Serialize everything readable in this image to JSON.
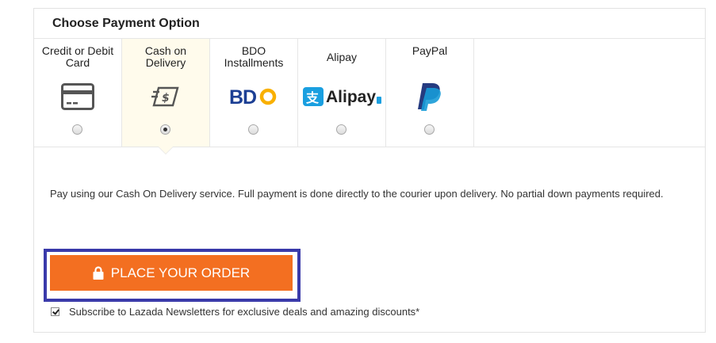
{
  "panel": {
    "title": "Choose Payment Option"
  },
  "payment_options": [
    {
      "label": "Credit or Debit Card",
      "icon": "credit-card-icon",
      "selected": false
    },
    {
      "label": "Cash on Delivery",
      "icon": "cash-on-delivery-icon",
      "selected": true
    },
    {
      "label": "BDO Installments",
      "icon": "bdo-logo",
      "logo_text": "BDO",
      "selected": false
    },
    {
      "label": "Alipay",
      "icon": "alipay-logo",
      "logo_text": "Alipay",
      "selected": false
    },
    {
      "label": "PayPal",
      "icon": "paypal-logo",
      "selected": false
    }
  ],
  "description": "Pay using our Cash On Delivery service. Full payment is done directly to the courier upon delivery. No partial down payments required.",
  "order_button": {
    "label": "PLACE YOUR ORDER",
    "color": "#f36f21",
    "icon": "lock-icon"
  },
  "subscribe": {
    "label": "Subscribe to Lazada Newsletters for exclusive deals and amazing discounts*",
    "checked": true
  },
  "colors": {
    "selected_bg": "#fffbec",
    "focus_outline": "#3a3aaa"
  }
}
